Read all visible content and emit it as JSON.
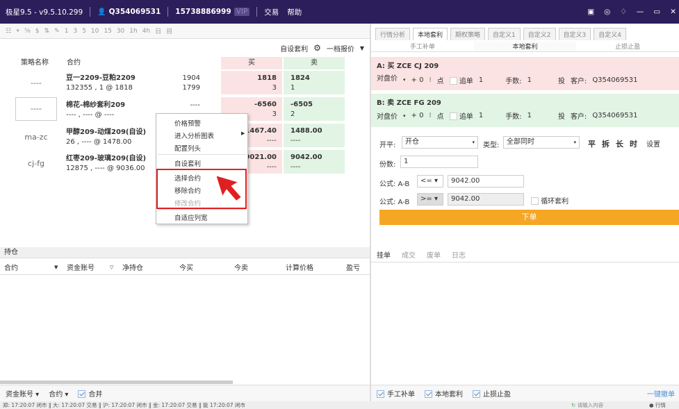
{
  "title_bar": {
    "app_version": "极星9.5 - v9.5.10.299",
    "account_id": "Q354069531",
    "phone": "15738886999",
    "vip": "VIP",
    "menu_trade": "交易",
    "menu_help": "帮助"
  },
  "toolbar": {
    "items": [
      "☷",
      "⌖",
      "⅝",
      "$",
      "⇅",
      "✎",
      "1",
      "3",
      "5",
      "10",
      "15",
      "30",
      "1h",
      "4h",
      "日",
      "目"
    ]
  },
  "left_header": {
    "custom_arb": "自设套利",
    "quote_mode": "一档报价"
  },
  "grid": {
    "col_strategy": "策略名称",
    "col_contract": "合约",
    "col_buy": "买",
    "col_sell": "卖",
    "rows": [
      {
        "strategy": "----",
        "name": "豆一2209-豆粕2209",
        "sub": "132355 , 1 @ 1818",
        "v1": "1904",
        "v2": "1799",
        "buy": "1818",
        "buy_qty": "3",
        "sell": "1824",
        "sell_qty": "1"
      },
      {
        "strategy": "----",
        "name": "棉花-棉纱套利209",
        "sub": "---- , ---- @ ----",
        "v1": "----",
        "v2": "",
        "buy": "-6560",
        "buy_qty": "3",
        "sell": "-6505",
        "sell_qty": "2"
      },
      {
        "strategy": "ma-zc",
        "name": "甲醇209-动煤209(自设)",
        "sub": "26 , ---- @ 1478.00",
        "v1": "",
        "v2": "",
        "buy": "1467.40",
        "buy_qty": "----",
        "sell": "1488.00",
        "sell_qty": "----"
      },
      {
        "strategy": "cj-fg",
        "name": "红枣209-玻璃209(自设)",
        "sub": "12875 , ---- @ 9036.00",
        "v1": "",
        "v2": "",
        "buy": "9021.00",
        "buy_qty": "----",
        "sell": "9042.00",
        "sell_qty": "----"
      }
    ]
  },
  "context_menu": {
    "price_alert": "价格预警",
    "enter_chart": "进入分析图表",
    "config_header": "配置列头",
    "custom_arb": "自设套利",
    "select_contract": "选择合约",
    "remove_contract": "移除合约",
    "modify_contract": "修改合约",
    "auto_width": "自适应列宽"
  },
  "positions": {
    "title": "持仓",
    "cols": [
      "合约",
      "资金账号",
      "净持仓",
      "今买",
      "今卖",
      "计算价格",
      "盈亏"
    ]
  },
  "left_footer": {
    "fund_account": "资金账号",
    "contract": "合约",
    "merge": "合并"
  },
  "right_tabs": [
    "行情分析",
    "本地套利",
    "期权策略",
    "自定义1",
    "自定义2",
    "自定义3",
    "自定义4"
  ],
  "right_subtabs": [
    "手工补单",
    "本地套利",
    "止损止盈"
  ],
  "leg_a": {
    "title": "A: 买 ZCE CJ 209",
    "price_type": "对盘价",
    "offset": "+ 0",
    "tick": "点",
    "chase": "追单",
    "chase_val": "1",
    "lots_label": "手数:",
    "lots": "1",
    "spec": "投",
    "customer": "客户:",
    "customer_id": "Q354069531"
  },
  "leg_b": {
    "title": "B: 卖 ZCE FG 209",
    "price_type": "对盘价",
    "offset": "+ 0",
    "tick": "点",
    "chase": "追单",
    "chase_val": "1",
    "lots_label": "手数:",
    "lots": "1",
    "spec": "投",
    "customer": "客户:",
    "customer_id": "Q354069531"
  },
  "order_form": {
    "open_label": "开平:",
    "open_value": "开仓",
    "type_label": "类型:",
    "type_value": "全部同时",
    "btn_ping": "平",
    "btn_chai": "拆",
    "btn_chang": "长",
    "btn_shi": "时",
    "settings": "设置",
    "qty_label": "份数:",
    "qty": "1",
    "formula1_label": "公式: A-B",
    "formula1_op": "<=",
    "formula1_val": "9042.00",
    "formula2_label": "公式: A-B",
    "formula2_op": ">=",
    "formula2_val": "9042.00",
    "loop_arb": "循环套利",
    "submit": "下单"
  },
  "order_tabs": [
    "挂单",
    "成交",
    "废单",
    "日志"
  ],
  "right_footer": {
    "manual": "手工补单",
    "local_arb": "本地套利",
    "stop": "止损止盈",
    "cancel_all": "一键撤单",
    "search_placeholder": "请输入内容",
    "market": "行情"
  },
  "status_bar": "郑: 17:20:07  闭市 ‖ 大: 17:20:07  交易 ‖ 沪: 17:20:07  闭市 ‖ 金: 17:20:07  交易 ‖ 能 17:20:07  闭市"
}
